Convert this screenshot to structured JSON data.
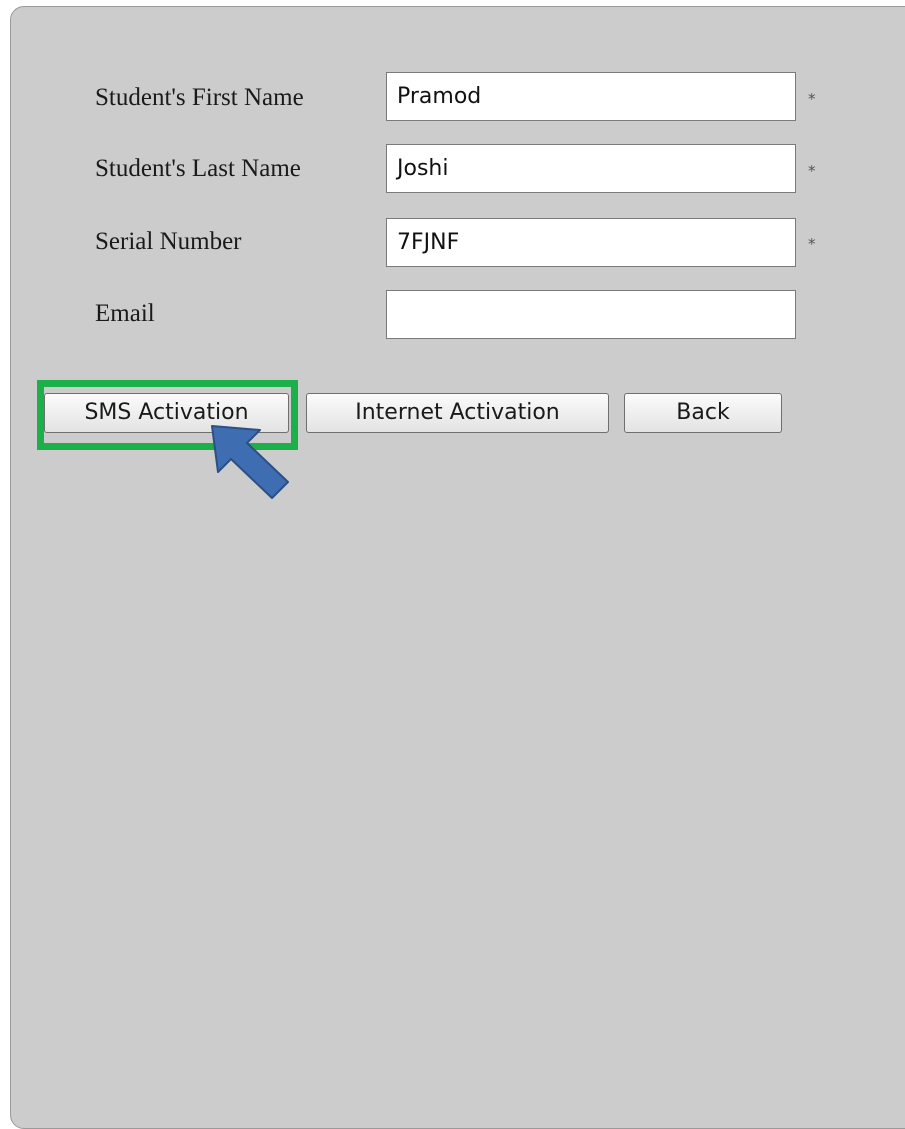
{
  "form": {
    "first_name": {
      "label": "Student's First Name",
      "value": "Pramod",
      "required_mark": "*"
    },
    "last_name": {
      "label": "Student's Last Name",
      "value": "Joshi",
      "required_mark": "*"
    },
    "serial_number": {
      "label": "Serial Number",
      "value": "7FJNF",
      "required_mark": "*"
    },
    "email": {
      "label": "Email",
      "value": ""
    }
  },
  "buttons": {
    "sms_activation": "SMS Activation",
    "internet_activation": "Internet Activation",
    "back": "Back"
  },
  "annotation": {
    "highlight_color": "#1db04a",
    "arrow_color": "#3e6db2",
    "arrow_icon": "arrow-pointer-icon"
  },
  "colors": {
    "panel_background": "#cccccc",
    "field_background": "#ffffff"
  }
}
